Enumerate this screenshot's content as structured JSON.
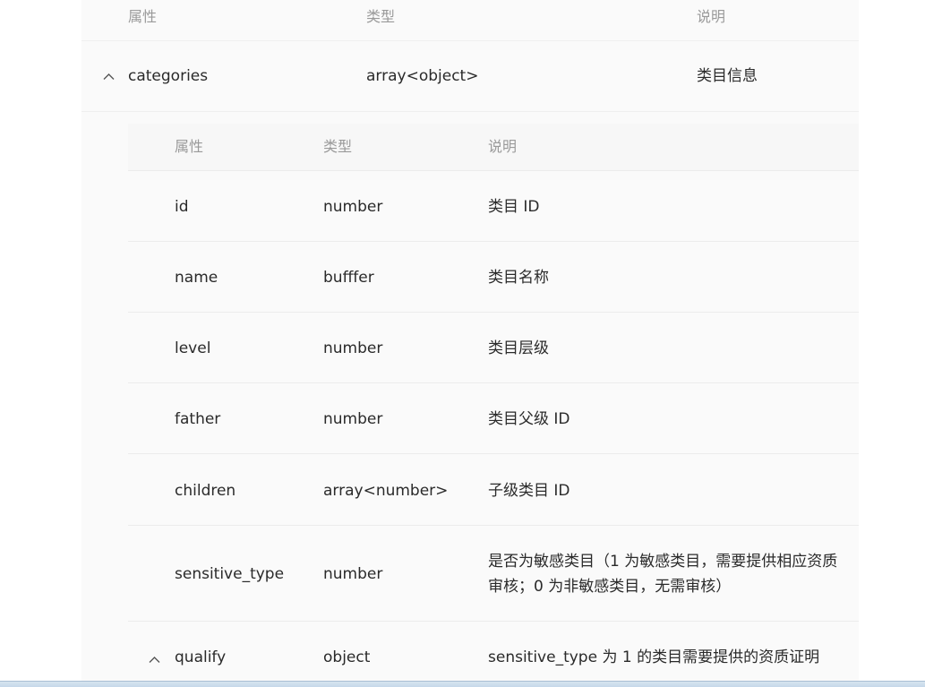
{
  "outer": {
    "headers": {
      "property": "属性",
      "type": "类型",
      "description": "说明"
    },
    "row": {
      "property": "categories",
      "type": "array<object>",
      "description": "类目信息"
    }
  },
  "inner": {
    "headers": {
      "property": "属性",
      "type": "类型",
      "description": "说明"
    },
    "rows": [
      {
        "property": "id",
        "type": "number",
        "description": "类目 ID"
      },
      {
        "property": "name",
        "type": "bufffer",
        "description": "类目名称"
      },
      {
        "property": "level",
        "type": "number",
        "description": "类目层级"
      },
      {
        "property": "father",
        "type": "number",
        "description": "类目父级 ID"
      },
      {
        "property": "children",
        "type": "array<number>",
        "description": "子级类目 ID"
      },
      {
        "property": "sensitive_type",
        "type": "number",
        "description": "是否为敏感类目（1 为敏感类目，需要提供相应资质审核；0 为非敏感类目，无需审核）"
      },
      {
        "property": "qualify",
        "type": "object",
        "description": "sensitive_type 为 1 的类目需要提供的资质证明"
      }
    ]
  },
  "icons": {
    "expand": "chevron-up-icon"
  }
}
